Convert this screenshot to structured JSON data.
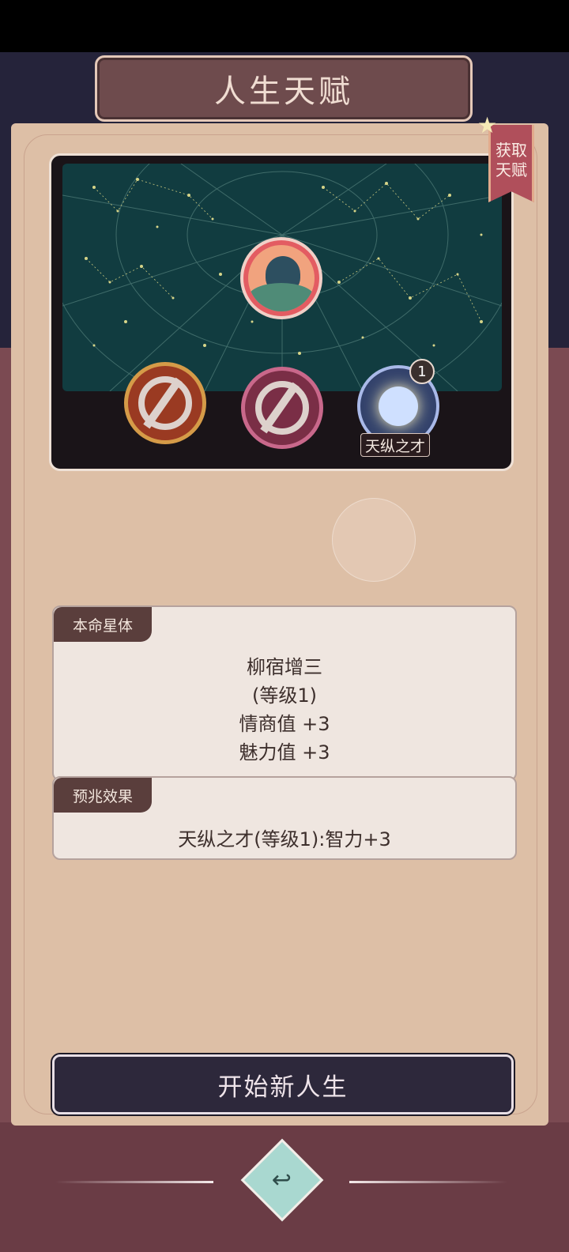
{
  "header": {
    "title": "人生天赋"
  },
  "ribbon": {
    "label_line1": "获取",
    "label_line2": "天赋"
  },
  "star_map": {
    "center_slot_icon": "zodiac-constellation-icon",
    "slots": [
      {
        "state": "empty",
        "icon": "empty-slot-icon"
      },
      {
        "state": "empty",
        "icon": "empty-slot-icon"
      },
      {
        "state": "filled",
        "icon": "orbit-orb-icon",
        "badge": "1",
        "label": "天纵之才"
      }
    ]
  },
  "destiny_card": {
    "tab_label": "本命星体",
    "lines": [
      "柳宿增三",
      "(等级1)",
      "情商值 +3",
      "魅力值 +3"
    ]
  },
  "omen_card": {
    "tab_label": "预兆效果",
    "text": "天纵之才(等级1):智力+3"
  },
  "buttons": {
    "start": "开始新人生",
    "back_icon": "back-arrow-icon"
  },
  "colors": {
    "panel": "#ddbfa6",
    "title_plate": "#6e4b4d",
    "start_button": "#2d283b",
    "ribbon": "#b04f5b"
  }
}
